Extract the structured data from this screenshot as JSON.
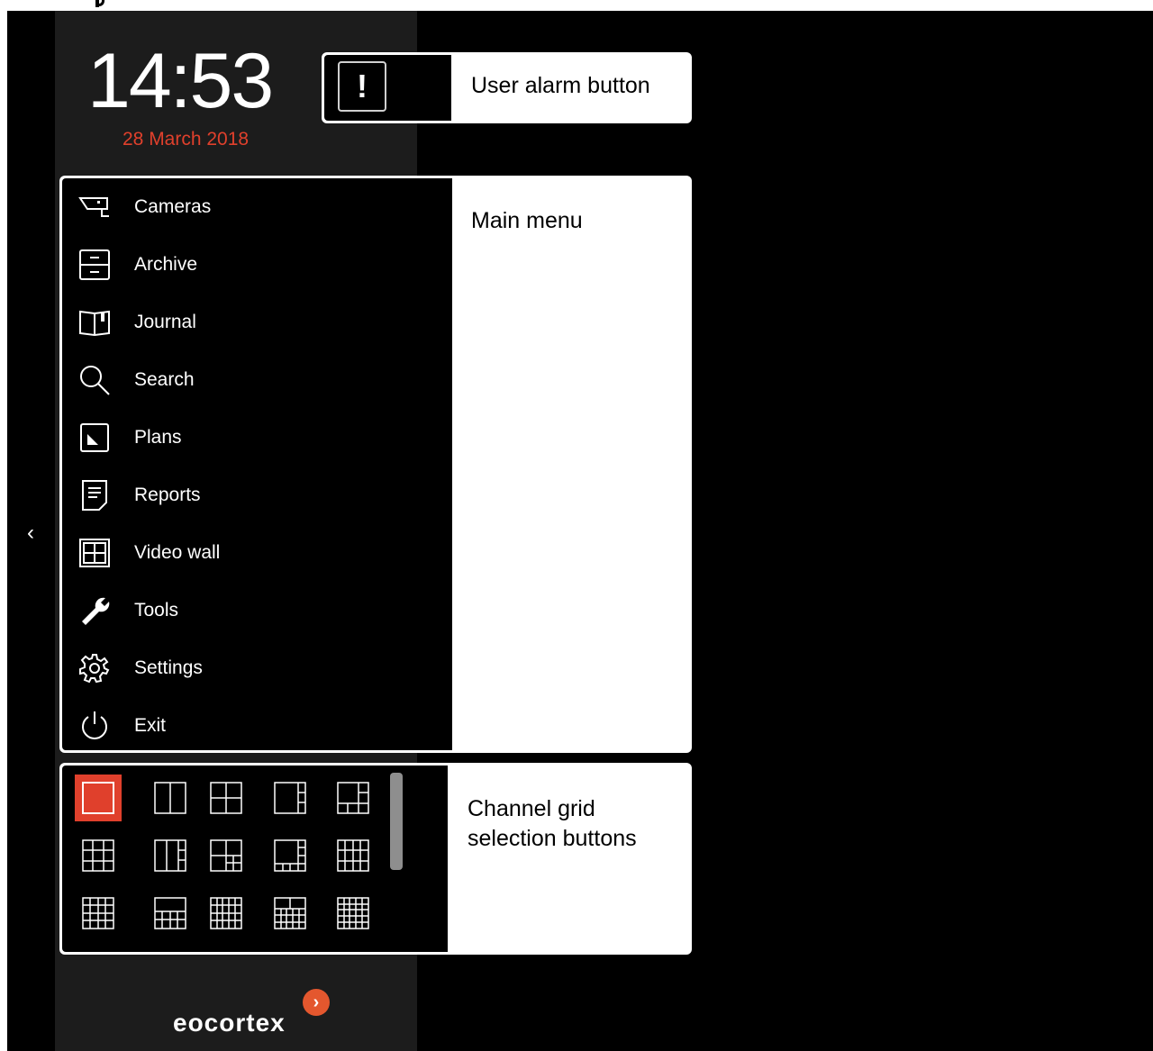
{
  "header": {
    "time": "14:53",
    "date": "28 March 2018"
  },
  "alarm": {
    "icon": "exclamation-icon",
    "symbol": "!",
    "callout_label": "User alarm button"
  },
  "menu": {
    "callout_label": "Main menu",
    "items": [
      {
        "label": "Cameras",
        "icon": "camera-icon"
      },
      {
        "label": "Archive",
        "icon": "archive-icon"
      },
      {
        "label": "Journal",
        "icon": "journal-icon"
      },
      {
        "label": "Search",
        "icon": "search-icon"
      },
      {
        "label": "Plans",
        "icon": "plans-icon"
      },
      {
        "label": "Reports",
        "icon": "reports-icon"
      },
      {
        "label": "Video wall",
        "icon": "video-wall-icon"
      },
      {
        "label": "Tools",
        "icon": "wrench-icon"
      },
      {
        "label": "Settings",
        "icon": "gear-icon"
      },
      {
        "label": "Exit",
        "icon": "power-icon"
      }
    ]
  },
  "grid": {
    "callout_line1": "Channel grid",
    "callout_line2": "selection buttons",
    "selected_index": 0,
    "buttons": 15
  },
  "nav": {
    "collapse_symbol": "‹"
  },
  "brand": {
    "name": "eocortex",
    "badge_symbol": "›"
  },
  "colors": {
    "accent": "#e0402c",
    "panel": "#1c1c1c",
    "background": "#000000",
    "callout": "#ffffff"
  }
}
